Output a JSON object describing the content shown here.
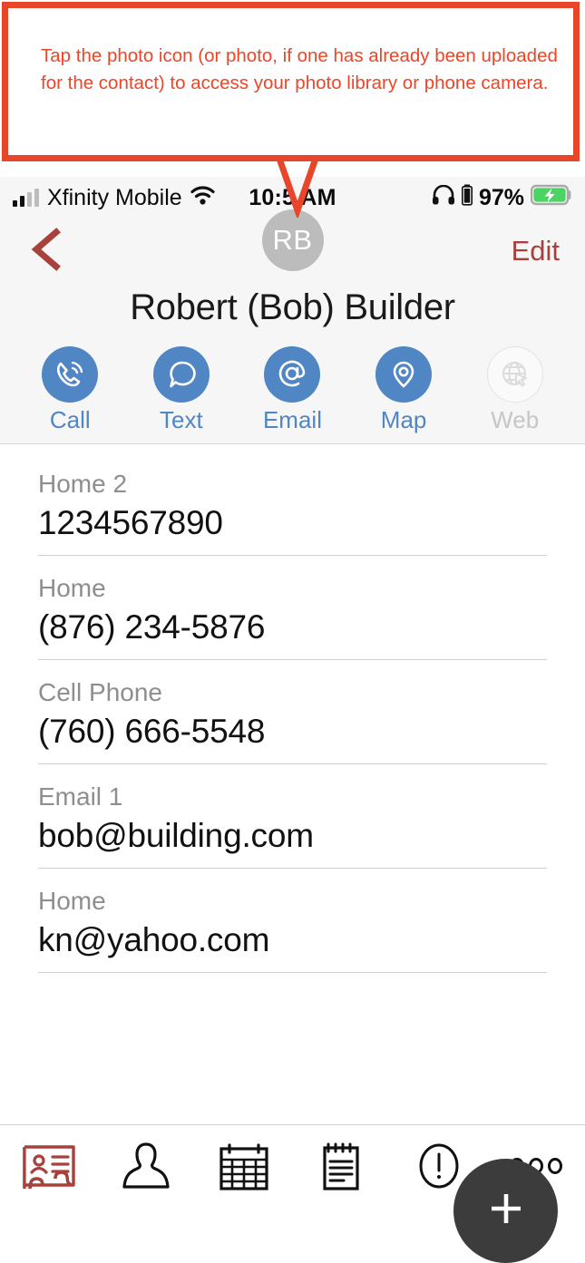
{
  "callout": {
    "text": "Tap the photo icon (or photo, if one has already been uploaded for the contact) to access your photo library or phone camera.",
    "border_color": "#E8462A",
    "text_color": "#EE4526"
  },
  "status_bar": {
    "carrier": "Xfinity Mobile",
    "wifi_icon": "wifi-icon",
    "signal_icon": "cellular-signal-icon",
    "time": "10:5  AM",
    "headphones_icon": "headphones-icon",
    "device_battery_icon": "device-battery-icon",
    "battery_percent": "97%",
    "battery_icon": "battery-charging-icon",
    "battery_color": "#4CD364"
  },
  "nav_bar": {
    "back_icon": "back-chevron-icon",
    "avatar_initials": "RB",
    "avatar_color": "#BCBCBC",
    "edit_label": "Edit",
    "accent_color": "#A8403C"
  },
  "contact": {
    "name": "Robert (Bob) Builder"
  },
  "actions": [
    {
      "label": "Call",
      "icon": "phone-call-icon",
      "enabled": true
    },
    {
      "label": "Text",
      "icon": "speech-bubble-icon",
      "enabled": true
    },
    {
      "label": "Email",
      "icon": "at-sign-icon",
      "enabled": true
    },
    {
      "label": "Map",
      "icon": "map-pin-icon",
      "enabled": true
    },
    {
      "label": "Web",
      "icon": "globe-cursor-icon",
      "enabled": false
    }
  ],
  "action_color": "#5186C4",
  "action_disabled_color": "#C6C6C6",
  "fields": [
    {
      "label": "Home 2",
      "value": "1234567890"
    },
    {
      "label": "Home",
      "value": "(876) 234-5876"
    },
    {
      "label": "Cell Phone",
      "value": "(760) 666-5548"
    },
    {
      "label": "Email 1",
      "value": "bob@building.com"
    },
    {
      "label": "Home",
      "value": "kn@yahoo.com"
    }
  ],
  "fab": {
    "icon": "plus-icon",
    "color": "#3C3C3C"
  },
  "tab_bar": [
    {
      "icon": "contact-card-icon",
      "active": true
    },
    {
      "icon": "person-icon",
      "active": false
    },
    {
      "icon": "calendar-grid-icon",
      "active": false
    },
    {
      "icon": "notepad-icon",
      "active": false
    },
    {
      "icon": "exclamation-circle-icon",
      "active": false
    },
    {
      "icon": "more-ellipsis-icon",
      "active": false
    }
  ]
}
